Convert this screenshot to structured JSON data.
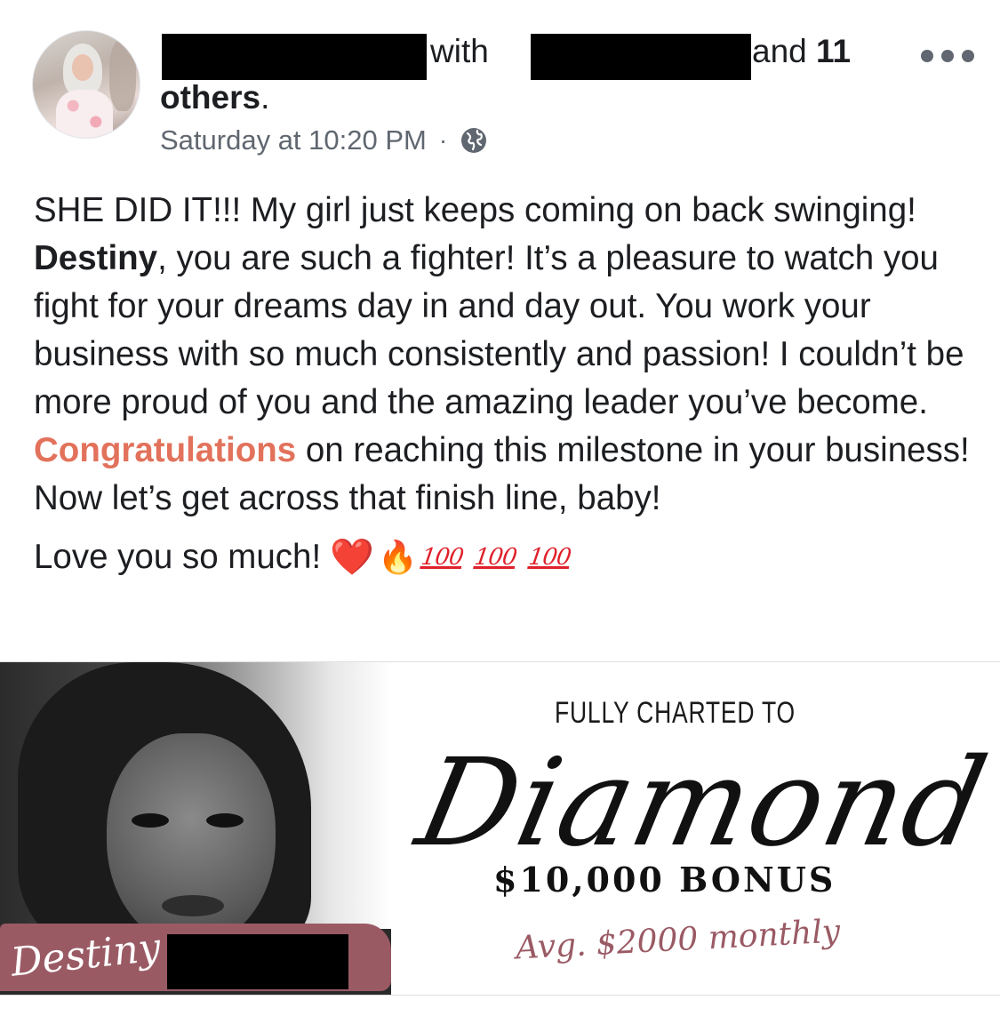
{
  "post": {
    "header": {
      "with_text": "with",
      "and_text": "and",
      "others_count": "11",
      "others_label": "others",
      "others_period": "."
    },
    "timestamp": "Saturday at 10:20 PM",
    "separator": "·",
    "privacy_icon": "globe-icon",
    "more_icon": "more-options-icon",
    "text": {
      "part1": "SHE DID IT!!! My girl just keeps coming on back swinging! ",
      "mention": "Destiny",
      "part2": ", you are such a fighter! It’s a pleasure to watch you fight for your dreams day in and day out. You work your business with so much consistently and passion! I couldn’t be more proud of you and the amazing leader you’ve become. ",
      "highlight": "Congratulations",
      "part3": " on reaching this milestone in your business! Now let’s get across that finish line, baby!",
      "love": "Love you so much!",
      "emoji_heart": "❤️",
      "emoji_fire": "🔥",
      "hundred": "100"
    },
    "accent_color": "#e2725b"
  },
  "image": {
    "name_script": "Destiny",
    "charted": "FULLY CHARTED TO",
    "diamond": "Diamond",
    "bonus": "$10,000 BONUS",
    "avg": "Avg. $2000 monthly",
    "brush_color": "#9a5a64"
  }
}
